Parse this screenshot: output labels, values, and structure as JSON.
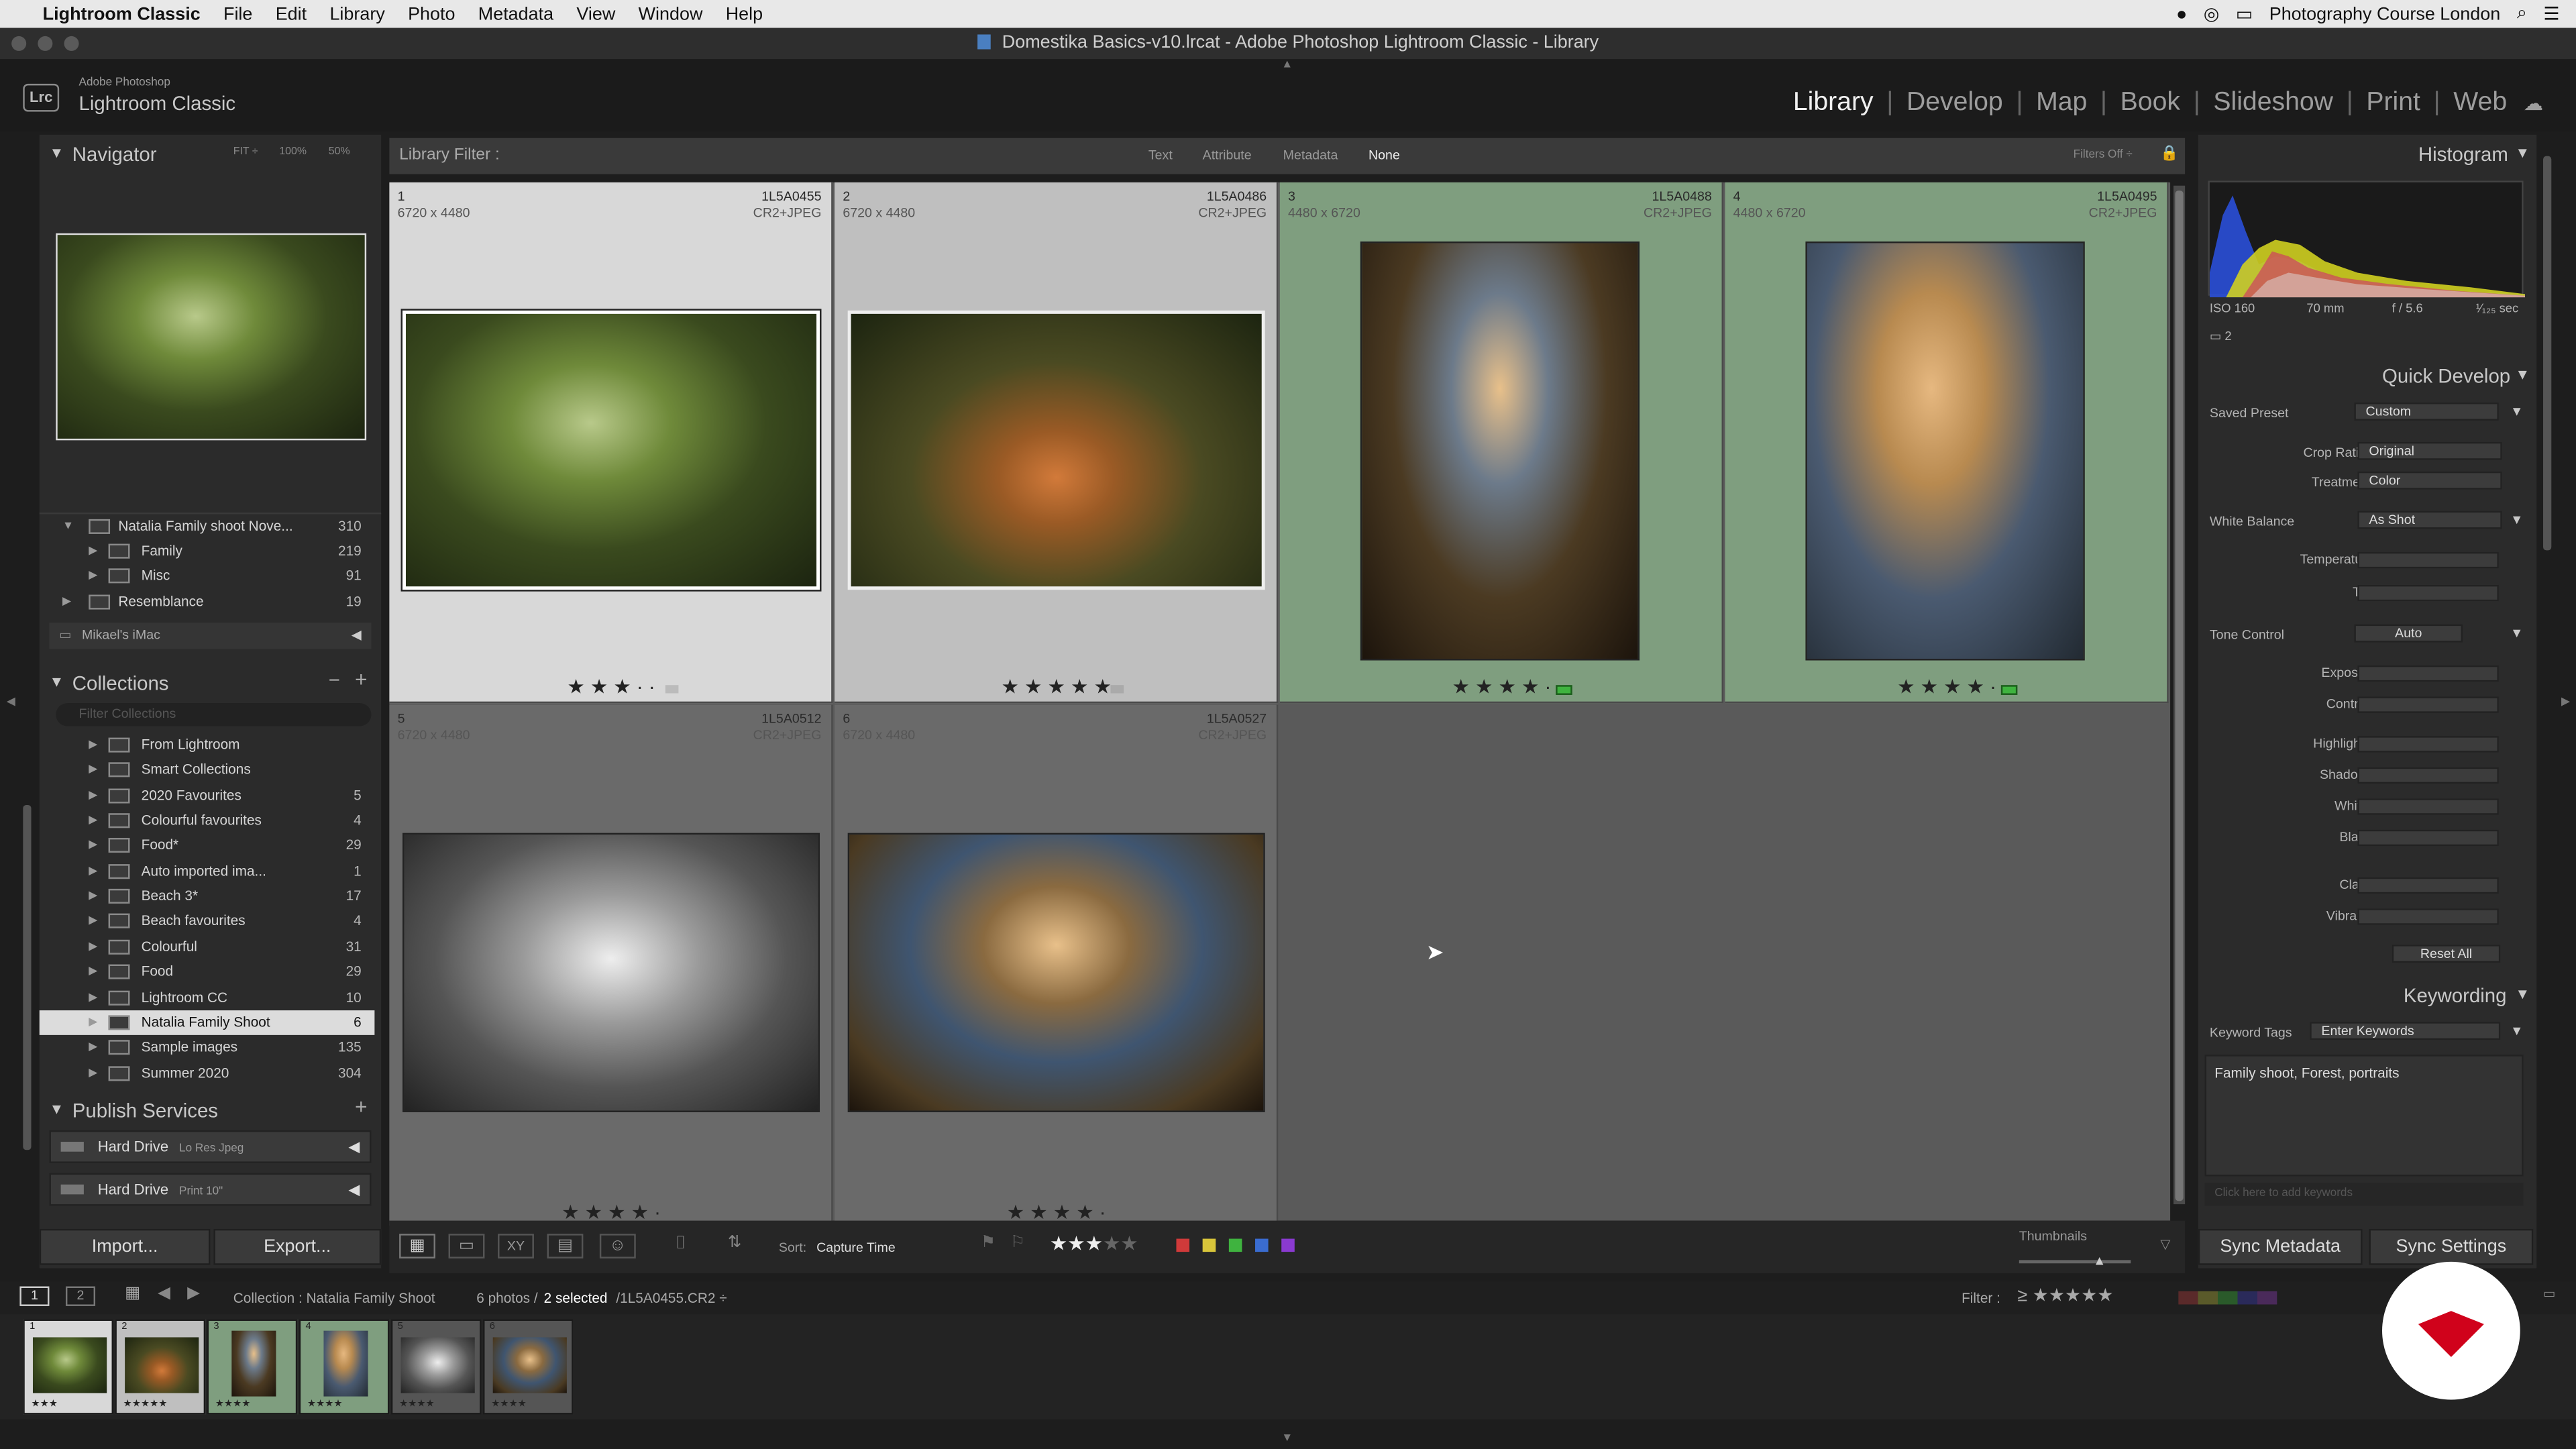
{
  "menubar": {
    "app": "Lightroom Classic",
    "items": [
      "File",
      "Edit",
      "Library",
      "Photo",
      "Metadata",
      "View",
      "Window",
      "Help"
    ],
    "right_title": "Photography Course London"
  },
  "window_title": "Domestika Basics-v10.lrcat - Adobe Photoshop Lightroom Classic - Library",
  "identity": {
    "logo": "Lrc",
    "line1": "Adobe Photoshop",
    "line2": "Lightroom Classic"
  },
  "modules": [
    "Library",
    "Develop",
    "Map",
    "Book",
    "Slideshow",
    "Print",
    "Web"
  ],
  "navigator": {
    "title": "Navigator",
    "fit": "FIT ÷",
    "z100": "100%",
    "z50": "50%"
  },
  "folders": [
    {
      "name": "Natalia Family shoot Nove...",
      "count": "310"
    },
    {
      "name": "Family",
      "count": "219"
    },
    {
      "name": "Misc",
      "count": "91"
    },
    {
      "name": "Resemblance",
      "count": "19"
    }
  ],
  "volume": "Mikael's iMac",
  "collections": {
    "title": "Collections",
    "filter_placeholder": "Filter Collections",
    "items": [
      {
        "name": "From Lightroom",
        "count": ""
      },
      {
        "name": "Smart Collections",
        "count": ""
      },
      {
        "name": "2020 Favourites",
        "count": "5"
      },
      {
        "name": "Colourful favourites",
        "count": "4"
      },
      {
        "name": "Food*",
        "count": "29"
      },
      {
        "name": "Auto imported ima...",
        "count": "1"
      },
      {
        "name": "Beach 3*",
        "count": "17"
      },
      {
        "name": "Beach favourites",
        "count": "4"
      },
      {
        "name": "Colourful",
        "count": "31"
      },
      {
        "name": "Food",
        "count": "29"
      },
      {
        "name": "Lightroom CC",
        "count": "10"
      },
      {
        "name": "Natalia Family Shoot",
        "count": "6"
      },
      {
        "name": "Sample images",
        "count": "135"
      },
      {
        "name": "Summer 2020",
        "count": "304"
      }
    ]
  },
  "publish": {
    "title": "Publish Services",
    "services": [
      {
        "name": "Hard Drive",
        "sub": "Lo Res Jpeg"
      },
      {
        "name": "Hard Drive",
        "sub": "Print 10\""
      }
    ]
  },
  "buttons": {
    "import": "Import...",
    "export": "Export...",
    "sync_meta": "Sync Metadata",
    "sync_settings": "Sync Settings"
  },
  "library_filter": {
    "label": "Library Filter :",
    "tabs": [
      "Text",
      "Attribute",
      "Metadata",
      "None"
    ],
    "status": "Filters Off ÷"
  },
  "photos": [
    {
      "idx": "1",
      "dims": "6720 x 4480",
      "file": "1L5A0455",
      "fmt": "CR2+JPEG",
      "stars": "★ ★ ★  ·  ·"
    },
    {
      "idx": "2",
      "dims": "6720 x 4480",
      "file": "1L5A0486",
      "fmt": "CR2+JPEG",
      "stars": "★ ★ ★ ★ ★"
    },
    {
      "idx": "3",
      "dims": "4480 x 6720",
      "file": "1L5A0488",
      "fmt": "CR2+JPEG",
      "stars": "★ ★ ★ ★  ·"
    },
    {
      "idx": "4",
      "dims": "4480 x 6720",
      "file": "1L5A0495",
      "fmt": "CR2+JPEG",
      "stars": "★ ★ ★ ★  ·"
    },
    {
      "idx": "5",
      "dims": "6720 x 4480",
      "file": "1L5A0512",
      "fmt": "CR2+JPEG",
      "stars": "★ ★ ★ ★  ·"
    },
    {
      "idx": "6",
      "dims": "6720 x 4480",
      "file": "1L5A0527",
      "fmt": "CR2+JPEG",
      "stars": "★ ★ ★ ★  ·"
    }
  ],
  "toolbar": {
    "sort_label": "Sort:",
    "sort_value": "Capture Time",
    "thumbs_label": "Thumbnails"
  },
  "histogram": {
    "title": "Histogram",
    "iso": "ISO 160",
    "focal": "70 mm",
    "aperture": "f / 5.6",
    "shutter": "¹⁄₁₂₅ sec",
    "count": "2"
  },
  "quick_develop": {
    "title": "Quick Develop",
    "saved_preset_label": "Saved Preset",
    "saved_preset": "Custom",
    "crop_label": "Crop Ratio",
    "crop": "Original",
    "treatment_label": "Treatment",
    "treatment": "Color",
    "wb_label": "White Balance",
    "wb": "As Shot",
    "temp": "Temperature",
    "tint": "Tint",
    "tone_label": "Tone Control",
    "auto": "Auto",
    "tone_rows": [
      "Exposure",
      "Contrast",
      "Highlights",
      "Shadows",
      "Whites",
      "Blacks",
      "Clarity",
      "Vibrance"
    ],
    "reset": "Reset All"
  },
  "keywording": {
    "title": "Keywording",
    "tags_label": "Keyword Tags",
    "tags_mode": "Enter Keywords",
    "keywords": "Family shoot, Forest, portraits",
    "placeholder": "Click here to add keywords"
  },
  "filmbar": {
    "collection": "Collection : Natalia Family Shoot",
    "count": "6 photos /",
    "selected": "2 selected",
    "file": "/1L5A0455.CR2 ÷",
    "filter_label": "Filter :"
  },
  "film": [
    {
      "n": "1",
      "stars": "★★★"
    },
    {
      "n": "2",
      "stars": "★★★★★"
    },
    {
      "n": "3",
      "stars": "★★★★"
    },
    {
      "n": "4",
      "stars": "★★★★"
    },
    {
      "n": "5",
      "stars": "★★★★"
    },
    {
      "n": "6",
      "stars": "★★★★"
    }
  ],
  "colors": {
    "accent": "#9dc29a",
    "selected_cell": "#d8d8d8",
    "label_green": "#3fb33f",
    "brand_red": "#d0021b"
  }
}
